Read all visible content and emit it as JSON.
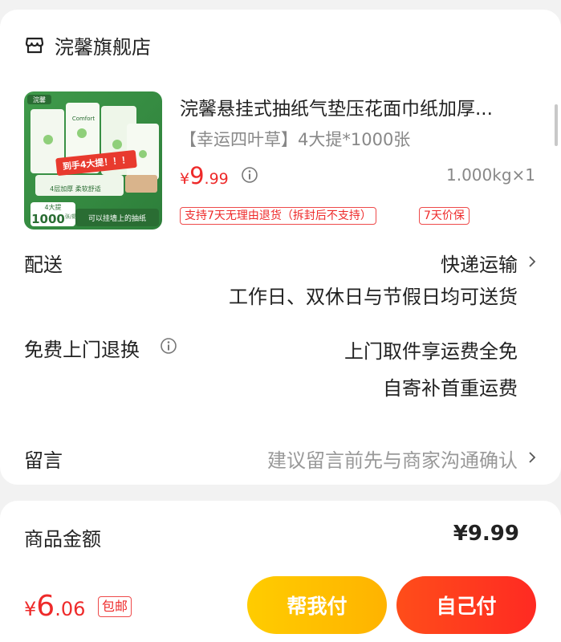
{
  "store": {
    "name": "浣馨旗舰店",
    "icon": "store-icon"
  },
  "product": {
    "title": "浣馨悬挂式抽纸气垫压花面巾纸加厚...",
    "spec": "【幸运四叶草】4大提*1000张",
    "price_symbol": "¥",
    "price_int": "9",
    "price_dec": ".99",
    "weight": "1.000kg×1",
    "tags": [
      "支持7天无理由退货（拆封后不支持）",
      "7天价保"
    ],
    "image": {
      "brand": "浣馨",
      "banner": "到手4大提！！！",
      "count_small": "4大提",
      "count_big": "1000",
      "count_unit": "张/提",
      "tagline": "4层加厚 柔软舒适",
      "slogan": "可以挂墙上的抽纸",
      "pack_label": "Comfort"
    }
  },
  "delivery": {
    "label": "配送",
    "method": "快递运输",
    "note": "工作日、双休日与节假日均可送货"
  },
  "return": {
    "label": "免费上门退换",
    "line1": "上门取件享运费全免",
    "line2": "自寄补首重运费"
  },
  "message": {
    "label": "留言",
    "placeholder": "建议留言前先与商家沟通确认"
  },
  "summary": {
    "label": "商品金额",
    "value": "¥9.99"
  },
  "bottom": {
    "price_symbol": "¥",
    "price_int": "6",
    "price_dec": ".06",
    "free_shipping": "包邮",
    "help_pay": "帮我付",
    "self_pay": "自己付"
  },
  "colors": {
    "accent": "#ee2a2a",
    "help_button": "#ffc107",
    "self_button": "#ff3a1f"
  }
}
